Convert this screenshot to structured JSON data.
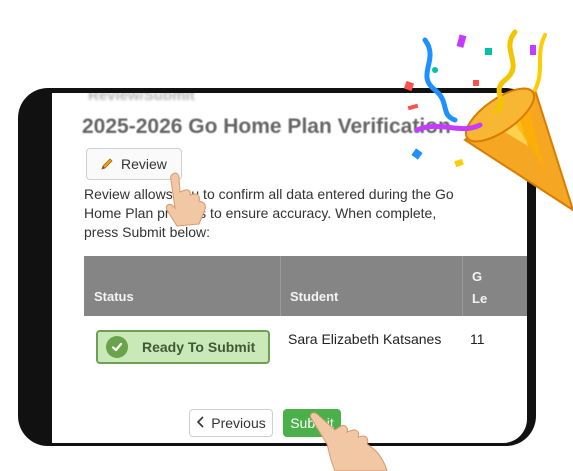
{
  "header": {
    "ghost_title": "Review/Submit",
    "title": "2025-2026 Go Home Plan Verification"
  },
  "toolbar": {
    "review_label": "Review",
    "pencil_icon": "pencil-icon"
  },
  "description": "Review allows you to confirm all data entered during the Go Home Plan process to ensure accuracy. When complete, press Submit below:",
  "table": {
    "columns": [
      "Status",
      "Student",
      "Grade Level"
    ],
    "grade_header_line1": "G",
    "grade_header_line2": "Le",
    "rows": [
      {
        "status": "Ready To Submit",
        "student": "Sara Elizabeth Katsanes",
        "grade": "11"
      }
    ]
  },
  "nav": {
    "previous_label": "Previous",
    "submit_label": "Submit"
  },
  "colors": {
    "header_bg": "#858585",
    "ready_bg": "#c9e9b9",
    "ready_border": "#6f9f55",
    "submit_bg": "#4cb04a"
  }
}
